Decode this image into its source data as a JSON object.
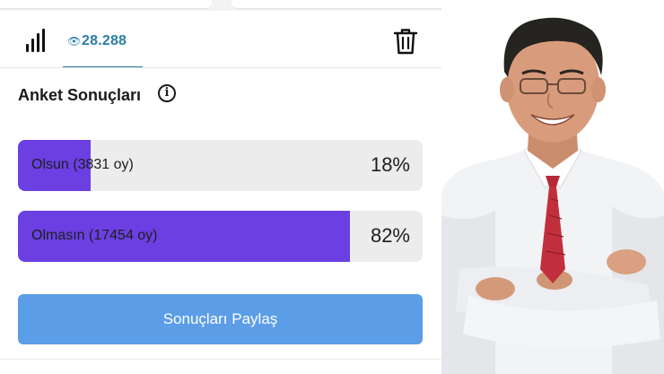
{
  "header": {
    "view_icon": "eye-icon",
    "view_count": "28.288",
    "stats_icon": "bar-chart-icon",
    "delete_icon": "trash-icon",
    "accent_color": "#2a7fa7"
  },
  "poll": {
    "title": "Anket Sonuçları",
    "info_icon": "info-icon",
    "bar_color": "#6b3fe2",
    "options": [
      {
        "label": "Olsun (3831 oy)",
        "percent_label": "18%",
        "share": 18
      },
      {
        "label": "Olmasın (17454 oy)",
        "percent_label": "82%",
        "share": 82
      }
    ],
    "share_button_label": "Sonuçları Paylaş",
    "share_button_color": "#5b9de6"
  },
  "photo": {
    "subject": "smiling-man-portrait"
  }
}
